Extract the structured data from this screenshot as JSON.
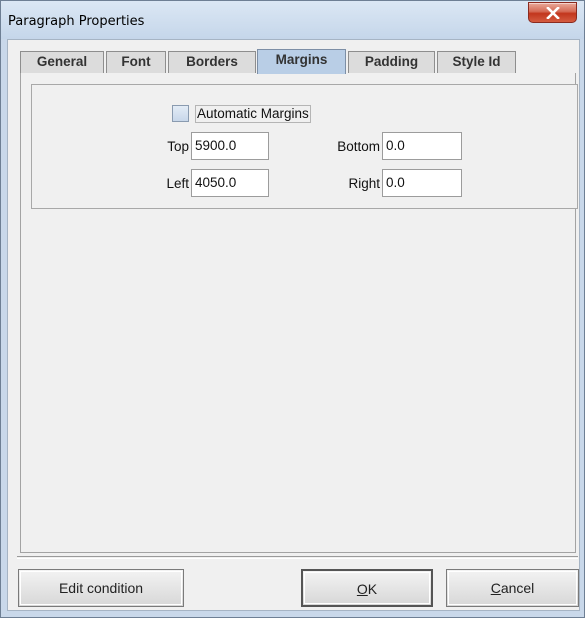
{
  "window": {
    "title": "Paragraph Properties",
    "close_icon": "close-icon"
  },
  "tabs": [
    {
      "label": "General",
      "selected": false
    },
    {
      "label": "Font",
      "selected": false
    },
    {
      "label": "Borders",
      "selected": false
    },
    {
      "label": "Margins",
      "selected": true
    },
    {
      "label": "Padding",
      "selected": false
    },
    {
      "label": "Style Id",
      "selected": false
    }
  ],
  "margins": {
    "automatic_label": "Automatic Margins",
    "automatic_checked": false,
    "top_label": "Top",
    "top_value": "5900.0",
    "bottom_label": "Bottom",
    "bottom_value": "0.0",
    "left_label": "Left",
    "left_value": "4050.0",
    "right_label": "Right",
    "right_value": "0.0"
  },
  "buttons": {
    "edit_condition": "Edit condition",
    "ok_mnemonic": "O",
    "ok_rest": "K",
    "cancel_mnemonic": "C",
    "cancel_rest": "ancel"
  },
  "colors": {
    "selected_tab": "#b9cee6",
    "close_button": "#c2361d",
    "frame": "#c9d8ea"
  }
}
